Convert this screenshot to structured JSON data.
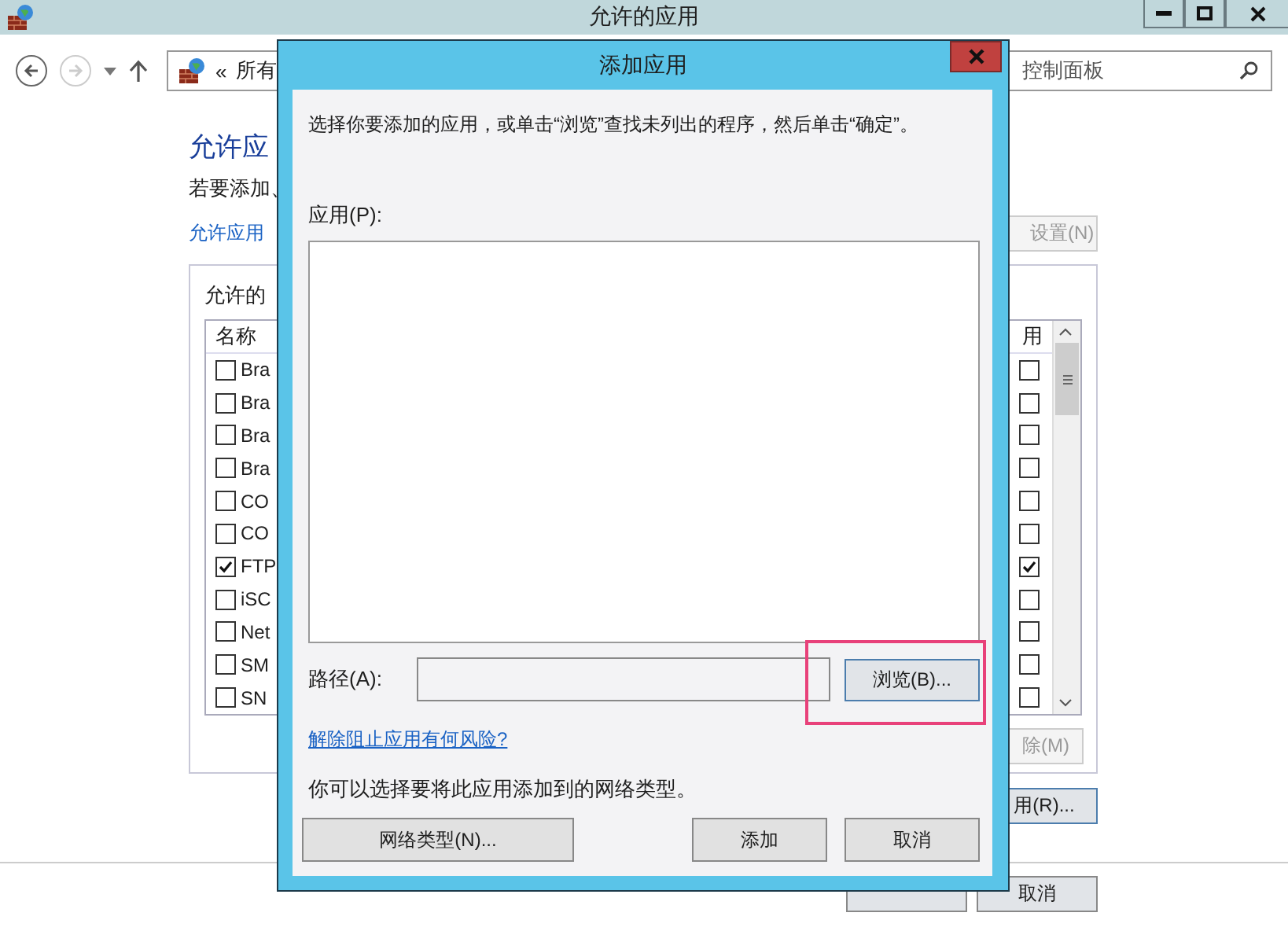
{
  "window": {
    "title": "允许的应用"
  },
  "nav": {
    "forward_disabled": true,
    "address_chevron": "«",
    "address_text": "所有",
    "search_placeholder": "控制面板"
  },
  "content": {
    "heading": "允许应",
    "intro": "若要添加、",
    "link": "允许应用",
    "settings_button": "设置(N)",
    "group_label": "允许的",
    "list": {
      "name_header": "名称",
      "public_header": "用",
      "rows": [
        {
          "name": "Bra",
          "checked": false,
          "public_checked": false
        },
        {
          "name": "Bra",
          "checked": false,
          "public_checked": false
        },
        {
          "name": "Bra",
          "checked": false,
          "public_checked": false
        },
        {
          "name": "Bra",
          "checked": false,
          "public_checked": false
        },
        {
          "name": "CO",
          "checked": false,
          "public_checked": false
        },
        {
          "name": "CO",
          "checked": false,
          "public_checked": false
        },
        {
          "name": "FTP",
          "checked": true,
          "public_checked": true
        },
        {
          "name": "iSC",
          "checked": false,
          "public_checked": false
        },
        {
          "name": "Net",
          "checked": false,
          "public_checked": false
        },
        {
          "name": "SM",
          "checked": false,
          "public_checked": false
        },
        {
          "name": "SN",
          "checked": false,
          "public_checked": false
        }
      ]
    },
    "remove_button": {
      "label": "除(M)",
      "disabled": true
    },
    "allow_other_button": "用(R)...",
    "footer_buttons": [
      "取消"
    ]
  },
  "dialog": {
    "title": "添加应用",
    "instruction": "选择你要添加的应用，或单击“浏览”查找未列出的程序，然后单击“确定”。",
    "apps_label": "应用(P):",
    "path_label": "路径(A):",
    "browse_button": "浏览(B)...",
    "browse_highlighted": true,
    "risk_link": "解除阻止应用有何风险?",
    "network_note": "你可以选择要将此应用添加到的网络类型。",
    "network_button": "网络类型(N)...",
    "buttons": [
      "添加",
      "取消"
    ]
  }
}
